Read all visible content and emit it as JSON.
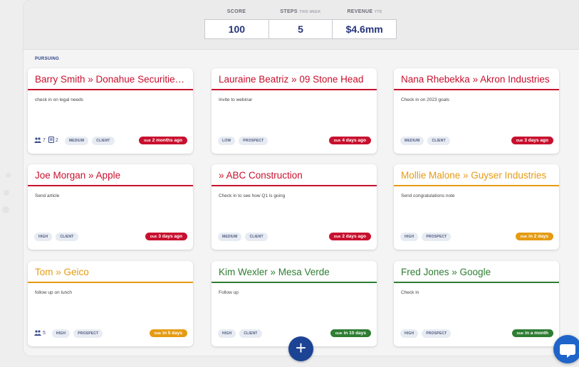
{
  "header": {
    "stats": [
      {
        "label": "SCORE",
        "sublabel": "",
        "value": "100"
      },
      {
        "label": "STEPS",
        "sublabel": "THIS WEEK",
        "value": "5"
      },
      {
        "label": "REVENUE",
        "sublabel": "YTD",
        "value": "$4.6mm"
      }
    ]
  },
  "section": {
    "label": "PURSUING"
  },
  "colors": {
    "overdue": "#c8102e",
    "soon": "#e59b12",
    "future": "#2e7d32",
    "accent": "#1c4394"
  },
  "cards": [
    {
      "title": "Barry Smith » Donahue Securities M...",
      "note": "check in on legal needs",
      "people_count": "7",
      "docs_count": "2",
      "tags": [
        "MEDIUM",
        "CLIENT"
      ],
      "due_prefix": "DUE",
      "due_text": "2 months ago",
      "status": "overdue"
    },
    {
      "title": "Lauraine Beatriz » 09 Stone Head",
      "note": "Invite to webinar",
      "tags": [
        "LOW",
        "PROSPECT"
      ],
      "due_prefix": "DUE",
      "due_text": "4 days ago",
      "status": "overdue"
    },
    {
      "title": "Nana Rhebekka » Akron Industries",
      "note": "Check in on 2023 goals",
      "tags": [
        "MEDIUM",
        "CLIENT"
      ],
      "due_prefix": "DUE",
      "due_text": "3 days ago",
      "status": "overdue"
    },
    {
      "title": "Joe Morgan » Apple",
      "note": "Send article",
      "tags": [
        "HIGH",
        "CLIENT"
      ],
      "due_prefix": "DUE",
      "due_text": "3 days ago",
      "status": "overdue"
    },
    {
      "title": "» ABC Construction",
      "note": "Check in to see how Q1 is going",
      "tags": [
        "MEDIUM",
        "CLIENT"
      ],
      "due_prefix": "DUE",
      "due_text": "2 days ago",
      "status": "overdue"
    },
    {
      "title": "Mollie Malone » Guyser Industries",
      "note": "Send congratulations note",
      "tags": [
        "HIGH",
        "PROSPECT"
      ],
      "due_prefix": "DUE",
      "due_text": "in 2 days",
      "status": "soon"
    },
    {
      "title": "Tom » Geico",
      "note": "follow up on lunch",
      "people_count": "5",
      "tags": [
        "HIGH",
        "PROSPECT"
      ],
      "due_prefix": "DUE",
      "due_text": "in 5 days",
      "status": "soon"
    },
    {
      "title": "Kim Wexler » Mesa Verde",
      "note": "Follow up",
      "tags": [
        "HIGH",
        "CLIENT"
      ],
      "due_prefix": "DUE",
      "due_text": "in 10 days",
      "status": "future"
    },
    {
      "title": "Fred Jones » Google",
      "note": "Check in",
      "tags": [
        "HIGH",
        "PROSPECT"
      ],
      "due_prefix": "DUE",
      "due_text": "in a month",
      "status": "future"
    }
  ],
  "actions": {
    "add_symbol": "+",
    "add_icon": "plus-icon",
    "chat_icon": "chat-bubble-icon"
  }
}
